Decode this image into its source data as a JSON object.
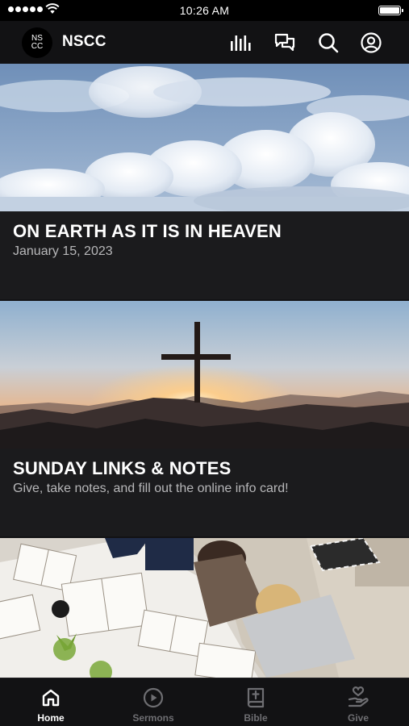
{
  "status_bar": {
    "time": "10:26 AM"
  },
  "header": {
    "logo_line1": "NS",
    "logo_line2": "CC",
    "title": "NSCC",
    "icons": [
      "audio-bars-icon",
      "chat-bubbles-icon",
      "search-icon",
      "account-icon"
    ]
  },
  "feed": {
    "cards": [
      {
        "title": "ON EARTH AS IT IS IN HEAVEN",
        "subtitle": "January 15, 2023",
        "image": "clouds-sky-image"
      },
      {
        "title": "SUNDAY LINKS & NOTES",
        "subtitle": "Give, take notes, and fill out the online info card!",
        "image": "cross-sunset-image"
      },
      {
        "title": "",
        "subtitle": "",
        "image": "bible-study-group-image"
      }
    ]
  },
  "tabs": [
    {
      "label": "Home",
      "icon": "home-icon",
      "active": true
    },
    {
      "label": "Sermons",
      "icon": "play-circle-icon",
      "active": false
    },
    {
      "label": "Bible",
      "icon": "bible-icon",
      "active": false
    },
    {
      "label": "Give",
      "icon": "give-hand-heart-icon",
      "active": false
    }
  ],
  "colors": {
    "background": "#121214",
    "card": "#1b1b1d",
    "accent": "#ffffff",
    "inactive_tab": "#6e6e72",
    "subtitle": "#b7b7b9"
  }
}
